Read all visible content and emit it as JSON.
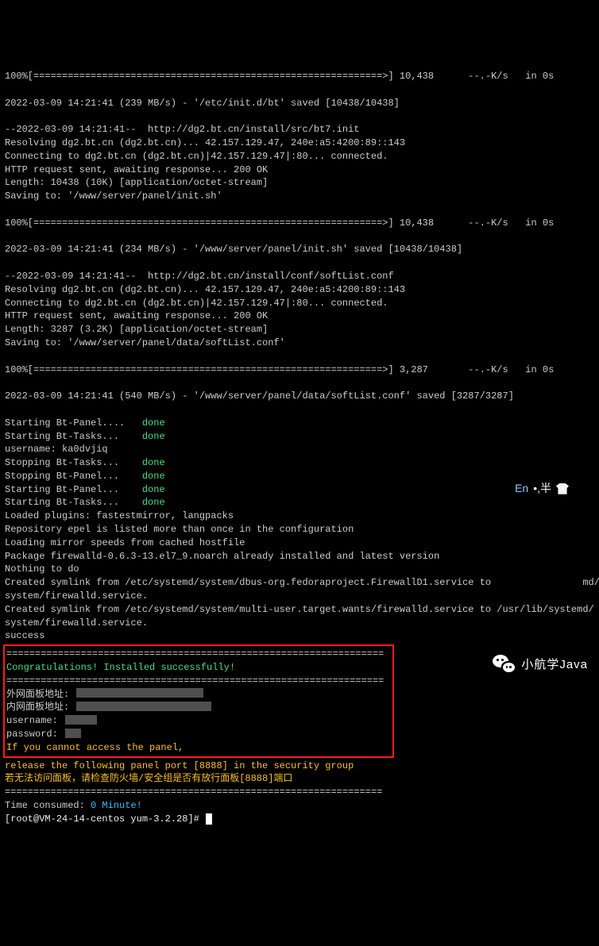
{
  "progress1": "100%[=============================================================>] 10,438      --.-K/s   in 0s",
  "saved1": "2022-03-09 14:21:41 (239 MB/s) - '/etc/init.d/bt' saved [10438/10438]",
  "dl2": {
    "start": "--2022-03-09 14:21:41--  http://dg2.bt.cn/install/src/bt7.init",
    "resolve": "Resolving dg2.bt.cn (dg2.bt.cn)... 42.157.129.47, 240e:a5:4200:89::143",
    "connect": "Connecting to dg2.bt.cn (dg2.bt.cn)|42.157.129.47|:80... connected.",
    "http": "HTTP request sent, awaiting response... 200 OK",
    "len": "Length: 10438 (10K) [application/octet-stream]",
    "save": "Saving to: '/www/server/panel/init.sh'"
  },
  "progress2": "100%[=============================================================>] 10,438      --.-K/s   in 0s",
  "saved2": "2022-03-09 14:21:41 (234 MB/s) - '/www/server/panel/init.sh' saved [10438/10438]",
  "dl3": {
    "start": "--2022-03-09 14:21:41--  http://dg2.bt.cn/install/conf/softList.conf",
    "resolve": "Resolving dg2.bt.cn (dg2.bt.cn)... 42.157.129.47, 240e:a5:4200:89::143",
    "connect": "Connecting to dg2.bt.cn (dg2.bt.cn)|42.157.129.47|:80... connected.",
    "http": "HTTP request sent, awaiting response... 200 OK",
    "len": "Length: 3287 (3.2K) [application/octet-stream]",
    "save": "Saving to: '/www/server/panel/data/softList.conf'"
  },
  "progress3": "100%[=============================================================>] 3,287       --.-K/s   in 0s",
  "saved3": "2022-03-09 14:21:41 (540 MB/s) - '/www/server/panel/data/softList.conf' saved [3287/3287]",
  "svc": {
    "s1": "Starting Bt-Panel....",
    "s2": "Starting Bt-Tasks...",
    "user": "username: ka0dvjiq",
    "s3": "Stopping Bt-Tasks...",
    "s4": "Stopping Bt-Panel...",
    "s5": "Starting Bt-Panel...",
    "s6": "Starting Bt-Tasks...",
    "done": "done"
  },
  "yum": {
    "plugins": "Loaded plugins: fastestmirror, langpacks",
    "repo": "Repository epel is listed more than once in the configuration",
    "mirror": "Loading mirror speeds from cached hostfile",
    "pkg": "Package firewalld-0.6.3-13.el7_9.noarch already installed and latest version",
    "nothing": "Nothing to do",
    "sym1a": "Created symlink from /etc/systemd/system/dbus-org.fedoraproject.FirewallD1.service to",
    "sym1b": "md/",
    "sym1c": "system/firewalld.service.",
    "sym2a": "Created symlink from /etc/systemd/system/multi-user.target.wants/firewalld.service to /usr/lib/systemd/",
    "sym2b": "system/firewalld.service.",
    "success": "success"
  },
  "box": {
    "divider": "==================================================================",
    "congrats": "Congratulations! Installed successfully!",
    "ext": "外网面板地址: ",
    "int": "内网面板地址: ",
    "u": "username: ",
    "p": "password: ",
    "warn": "If you cannot access the panel,"
  },
  "post": {
    "release": "release the following panel port [8888] in the security group",
    "cn": "若无法访问面板，请检查防火墙/安全组是否有放行面板[8888]端口",
    "divider": "==================================================================",
    "time_label": "Time consumed: ",
    "time_val": "0 Minute!",
    "prompt": "[root@VM-24-14-centos yum-3.2.28]# "
  },
  "ime": {
    "en": "En",
    "half": "•,半"
  },
  "watermark": "小航学Java"
}
